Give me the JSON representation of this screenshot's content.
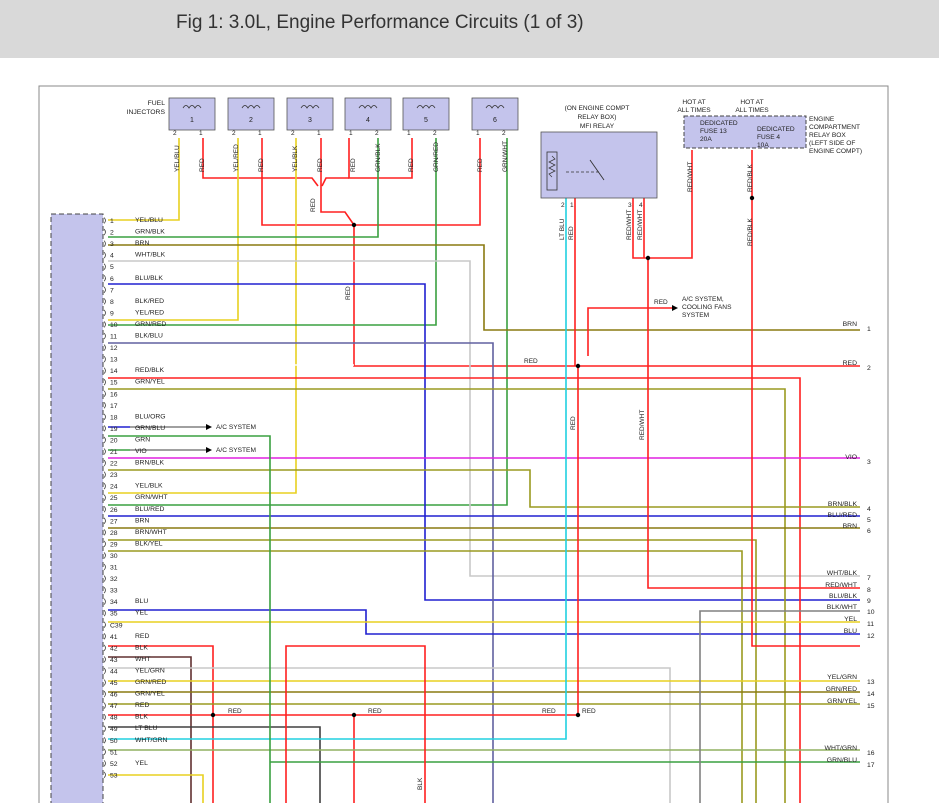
{
  "header": {
    "title": "Fig 1: 3.0L, Engine Performance Circuits (1 of 3)"
  },
  "labels": {
    "fuel_injectors": [
      "FUEL",
      "INJECTORS"
    ],
    "engine_compt": [
      "(ON ENGINE COMPT",
      "RELAY BOX)",
      "MFI RELAY"
    ],
    "hot_at_all_times": [
      "HOT AT",
      "ALL TIMES"
    ],
    "relay_box": [
      "ENGINE",
      "COMPARTMENT",
      "RELAY BOX",
      "(LEFT SIDE OF",
      "ENGINE COMPT)"
    ],
    "fuse13": [
      "DEDICATED",
      "FUSE 13",
      "20A"
    ],
    "fuse4": [
      "DEDICATED",
      "FUSE 4",
      "10A"
    ],
    "ac_system": "A/C SYSTEM",
    "ac_fans": [
      "A/C SYSTEM,",
      "COOLING FANS",
      "SYSTEM"
    ],
    "c39": "C39"
  },
  "injectors": [
    {
      "num": "1",
      "pins": [
        "2",
        "1"
      ],
      "wires": [
        "YEL/BLU",
        "RED"
      ]
    },
    {
      "num": "2",
      "pins": [
        "2",
        "1"
      ],
      "wires": [
        "YEL/RED",
        "RED"
      ]
    },
    {
      "num": "3",
      "pins": [
        "2",
        "1"
      ],
      "wires": [
        "YEL/BLK",
        "RED"
      ]
    },
    {
      "num": "4",
      "pins": [
        "1",
        "2"
      ],
      "wires": [
        "RED",
        "GRN/BLK"
      ]
    },
    {
      "num": "5",
      "pins": [
        "1",
        "2"
      ],
      "wires": [
        "RED",
        "GRN/RED"
      ]
    },
    {
      "num": "6",
      "pins": [
        "1",
        "2"
      ],
      "wires": [
        "RED",
        "GRN/WHT"
      ]
    }
  ],
  "relay_pins": [
    "2",
    "1",
    "3",
    "4"
  ],
  "relay_wires": [
    "LT BLU",
    "RED",
    "RED/WHT",
    "RED/WHT"
  ],
  "fuse_wires": [
    "RED/WHT",
    "RED/BLK"
  ],
  "mid_labels": {
    "red": "RED",
    "red_wht": "RED/WHT",
    "blk": "BLK"
  },
  "left_pins": [
    {
      "n": "1",
      "w": "YEL/BLU"
    },
    {
      "n": "2",
      "w": "GRN/BLK"
    },
    {
      "n": "3",
      "w": "BRN"
    },
    {
      "n": "4",
      "w": "WHT/BLK"
    },
    {
      "n": "5",
      "w": ""
    },
    {
      "n": "6",
      "w": "BLU/BLK"
    },
    {
      "n": "7",
      "w": ""
    },
    {
      "n": "8",
      "w": "BLK/RED"
    },
    {
      "n": "9",
      "w": "YEL/RED"
    },
    {
      "n": "10",
      "w": "GRN/RED"
    },
    {
      "n": "11",
      "w": "BLK/BLU"
    },
    {
      "n": "12",
      "w": ""
    },
    {
      "n": "13",
      "w": ""
    },
    {
      "n": "14",
      "w": "RED/BLK"
    },
    {
      "n": "15",
      "w": "GRN/YEL"
    },
    {
      "n": "16",
      "w": ""
    },
    {
      "n": "17",
      "w": ""
    },
    {
      "n": "18",
      "w": "BLU/ORG"
    },
    {
      "n": "19",
      "w": "GRN/BLU"
    },
    {
      "n": "20",
      "w": "GRN"
    },
    {
      "n": "21",
      "w": "VIO"
    },
    {
      "n": "22",
      "w": "BRN/BLK"
    },
    {
      "n": "23",
      "w": ""
    },
    {
      "n": "24",
      "w": "YEL/BLK"
    },
    {
      "n": "25",
      "w": "GRN/WHT"
    },
    {
      "n": "26",
      "w": "BLU/RED"
    },
    {
      "n": "27",
      "w": "BRN"
    },
    {
      "n": "28",
      "w": "BRN/WHT"
    },
    {
      "n": "29",
      "w": "BLK/YEL"
    },
    {
      "n": "30",
      "w": ""
    },
    {
      "n": "31",
      "w": ""
    },
    {
      "n": "32",
      "w": ""
    },
    {
      "n": "33",
      "w": ""
    },
    {
      "n": "34",
      "w": "BLU"
    },
    {
      "n": "35",
      "w": "YEL"
    },
    {
      "n": "C39",
      "w": ""
    },
    {
      "n": "41",
      "w": "RED"
    },
    {
      "n": "42",
      "w": "BLK"
    },
    {
      "n": "43",
      "w": "WHT"
    },
    {
      "n": "44",
      "w": "YEL/GRN"
    },
    {
      "n": "45",
      "w": "GRN/RED"
    },
    {
      "n": "46",
      "w": "GRN/YEL"
    },
    {
      "n": "47",
      "w": "RED"
    },
    {
      "n": "48",
      "w": "BLK"
    },
    {
      "n": "49",
      "w": "LT BLU"
    },
    {
      "n": "50",
      "w": "WHT/GRN"
    },
    {
      "n": "51",
      "w": ""
    },
    {
      "n": "52",
      "w": "YEL"
    },
    {
      "n": "53",
      "w": ""
    }
  ],
  "right_pins": [
    {
      "n": "1",
      "w": "BRN"
    },
    {
      "n": "2",
      "w": "RED"
    },
    {
      "n": "3",
      "w": "VIO"
    },
    {
      "n": "4",
      "w": "BRN/BLK"
    },
    {
      "n": "5",
      "w": "BLU/RED"
    },
    {
      "n": "6",
      "w": "BRN"
    },
    {
      "n": "7",
      "w": "WHT/BLK"
    },
    {
      "n": "8",
      "w": "RED/WHT"
    },
    {
      "n": "9",
      "w": "BLU/BLK"
    },
    {
      "n": "10",
      "w": "BLK/WHT"
    },
    {
      "n": "11",
      "w": "YEL"
    },
    {
      "n": "12",
      "w": "BLU"
    },
    {
      "n": "13",
      "w": "YEL/GRN"
    },
    {
      "n": "14",
      "w": "GRN/RED"
    },
    {
      "n": "15",
      "w": "GRN/YEL"
    },
    {
      "n": "16",
      "w": "WHT/GRN"
    },
    {
      "n": "17",
      "w": "GRN/BLU"
    }
  ],
  "colors": {
    "RED": "#ff2020",
    "YEL": "#e8d020",
    "GRN": "#3aa040",
    "BRN": "#8a7a10",
    "WHT": "#c8c8c8",
    "BLU": "#2020d0",
    "BLK": "#404040",
    "VIO": "#e020e0",
    "LTBLU": "#20d0e0",
    "OLV": "#9a9a20",
    "GRY": "#808080"
  }
}
